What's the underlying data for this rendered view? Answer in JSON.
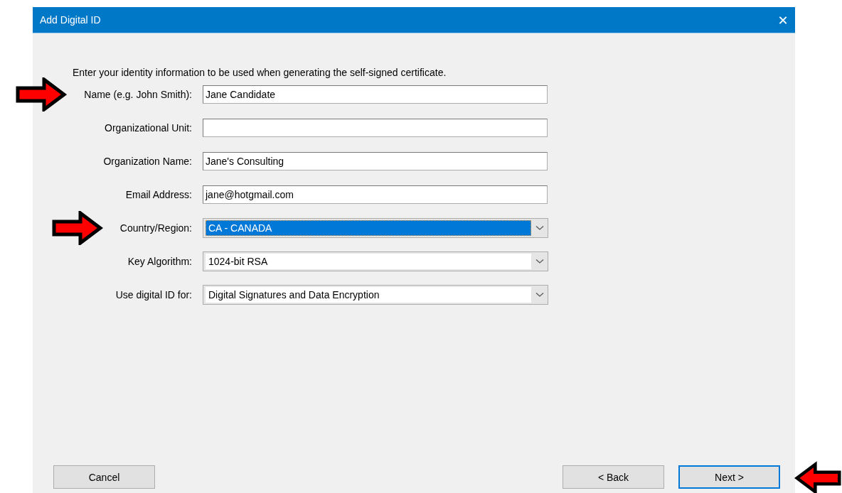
{
  "window": {
    "title": "Add Digital ID",
    "close": "✕"
  },
  "intro": "Enter your identity information to be used when generating the self-signed certificate.",
  "fields": [
    {
      "kind": "text",
      "label": "Name (e.g. John Smith):",
      "value": "Jane Candidate",
      "focused": false,
      "marked": true
    },
    {
      "kind": "text",
      "label": "Organizational Unit:",
      "focused": false,
      "marked": false
    },
    {
      "kind": "text",
      "label": "Organization Name:",
      "value": "Jane's Consulting",
      "focused": false,
      "marked": false
    },
    {
      "kind": "text",
      "label": "Email Address:",
      "value": "jane@hotgmail.com",
      "focused": false,
      "marked": false
    },
    {
      "kind": "dropdown",
      "label": "Country/Region:",
      "value": "CA - CANADA",
      "focused": true,
      "marked": true
    },
    {
      "kind": "dropdown",
      "label": "Key Algorithm:",
      "value": "1024-bit RSA",
      "focused": false,
      "marked": false
    },
    {
      "kind": "dropdown",
      "label": "Use digital ID for:",
      "value": "Digital Signatures and Data Encryption",
      "focused": false,
      "marked": false
    }
  ],
  "buttons": [
    {
      "label": "Cancel",
      "default": false,
      "marked": false
    },
    {
      "label": "< Back",
      "default": false,
      "marked": false
    },
    {
      "label": "Next >",
      "default": true,
      "marked": true
    }
  ]
}
